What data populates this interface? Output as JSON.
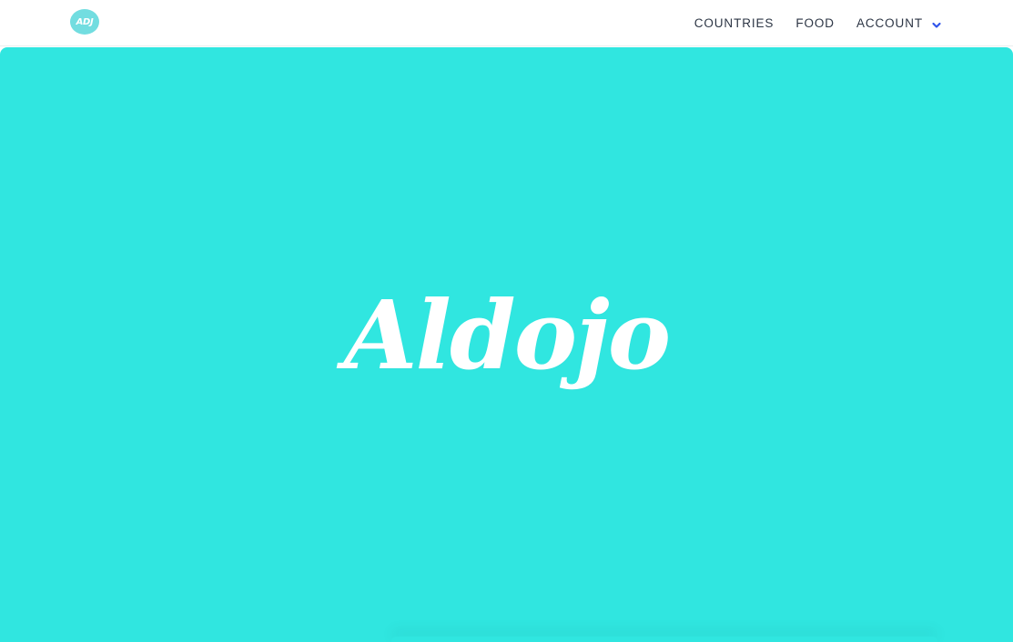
{
  "colors": {
    "brand": "#30E6E0",
    "logo_bg": "#72DDE0",
    "nav_text": "#2C3544",
    "chevron": "#2F54EB"
  },
  "header": {
    "logo_text": "ADJ",
    "nav": [
      {
        "label": "COUNTRIES"
      },
      {
        "label": "FOOD"
      },
      {
        "label": "ACCOUNT",
        "icon": "chevron-down-icon"
      }
    ]
  },
  "hero": {
    "title": "Aldojo"
  }
}
